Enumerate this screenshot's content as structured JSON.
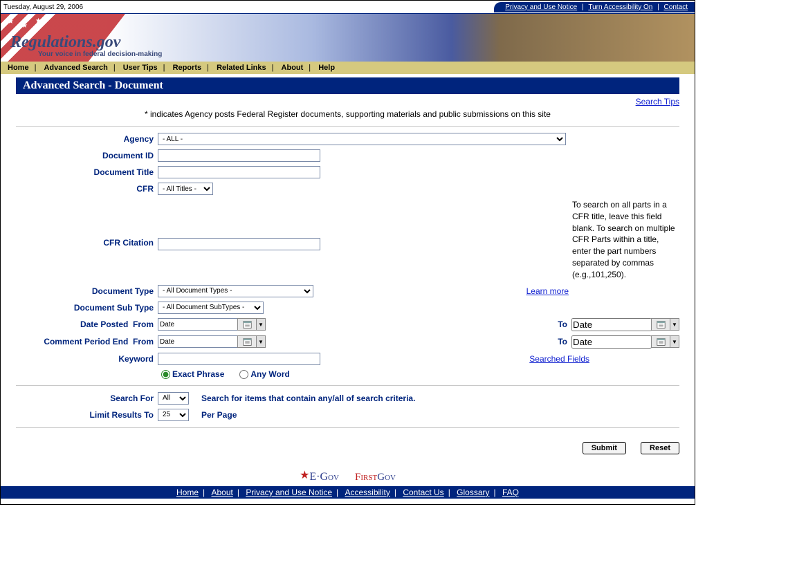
{
  "topbar": {
    "date": "Tuesday, August 29, 2006",
    "privacy": "Privacy and Use Notice",
    "accessibility": "Turn Accessibility On",
    "contact": "Contact"
  },
  "banner": {
    "title": "Regulations.gov",
    "subtitle": "Your voice in federal decision-making"
  },
  "nav": {
    "home": "Home",
    "advanced": "Advanced Search",
    "tips": "User Tips",
    "reports": "Reports",
    "related": "Related Links",
    "about": "About",
    "help": "Help"
  },
  "page": {
    "title": "Advanced Search - Document",
    "search_tips": "Search Tips",
    "note": "* indicates Agency posts Federal Register documents, supporting materials and public submissions on this site"
  },
  "form": {
    "agency_label": "Agency",
    "agency_value": "- ALL -",
    "doc_id_label": "Document ID",
    "doc_id_value": "",
    "doc_title_label": "Document Title",
    "doc_title_value": "",
    "cfr_label": "CFR",
    "cfr_value": "- All Titles -",
    "cfr_citation_label": "CFR Citation",
    "cfr_citation_value": "",
    "cfr_help": "To search on all parts in a CFR title, leave this field blank. To search on multiple CFR Parts within a title, enter the part numbers separated by commas (e.g.,101,250).",
    "doc_type_label": "Document Type",
    "doc_type_value": "- All Document Types -",
    "learn_more": "Learn more",
    "doc_subtype_label": "Document Sub Type",
    "doc_subtype_value": "- All Document SubTypes -",
    "date_posted_label": "Date Posted",
    "from_label": "From",
    "to_label": "To",
    "date_placeholder": "Date",
    "comment_end_label": "Comment Period End",
    "keyword_label": "Keyword",
    "keyword_value": "",
    "searched_fields": "Searched Fields",
    "exact_phrase": "Exact Phrase",
    "any_word": "Any Word",
    "search_for_label": "Search For",
    "search_for_value": "All",
    "search_for_desc": "Search for items that contain any/all of search criteria.",
    "limit_label": "Limit Results To",
    "limit_value": "25",
    "per_page": "Per Page",
    "submit": "Submit",
    "reset": "Reset"
  },
  "footer_logos": {
    "egov": "E·Gov",
    "firstgov_f": "First",
    "firstgov_g": "Gov"
  },
  "footer": {
    "home": "Home",
    "about": "About",
    "privacy": "Privacy and Use Notice",
    "accessibility": "Accessibility",
    "contact": "Contact Us",
    "glossary": "Glossary",
    "faq": "FAQ"
  }
}
